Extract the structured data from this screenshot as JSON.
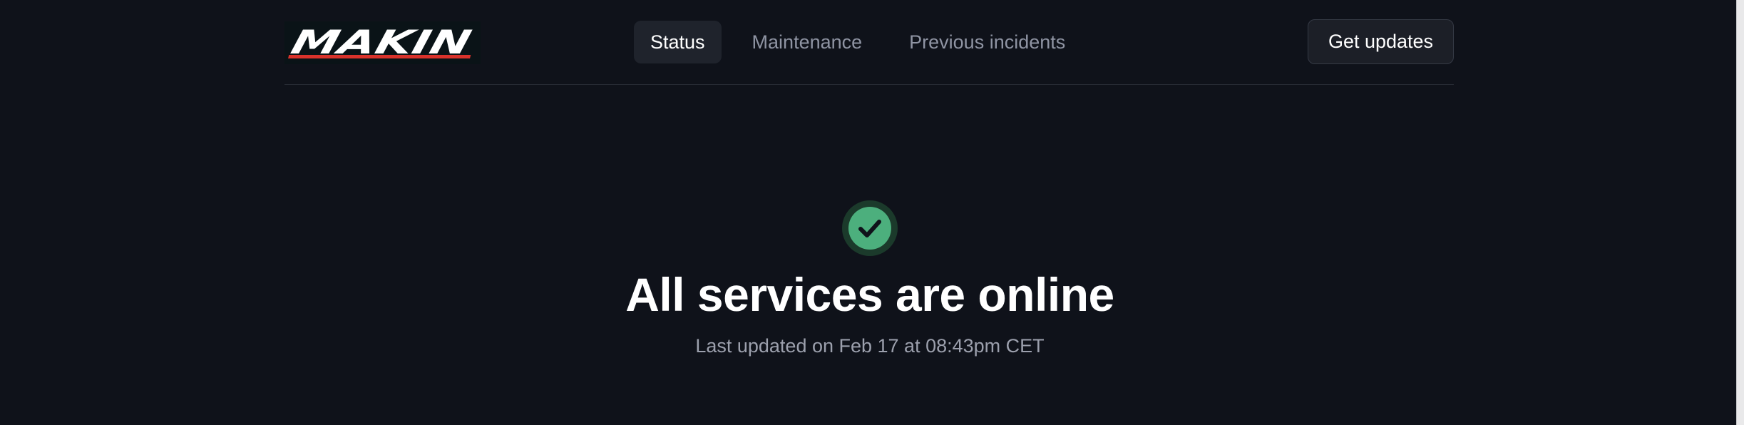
{
  "header": {
    "logo_text": "MAKIN",
    "nav": [
      {
        "label": "Status",
        "active": true
      },
      {
        "label": "Maintenance",
        "active": false
      },
      {
        "label": "Previous incidents",
        "active": false
      }
    ],
    "get_updates_label": "Get updates"
  },
  "status": {
    "icon": "check-circle-icon",
    "title": "All services are online",
    "last_updated": "Last updated on Feb 17 at 08:43pm CET",
    "color": "#4caf7d"
  },
  "colors": {
    "background": "#0f121a",
    "logo_accent": "#d9322b"
  }
}
